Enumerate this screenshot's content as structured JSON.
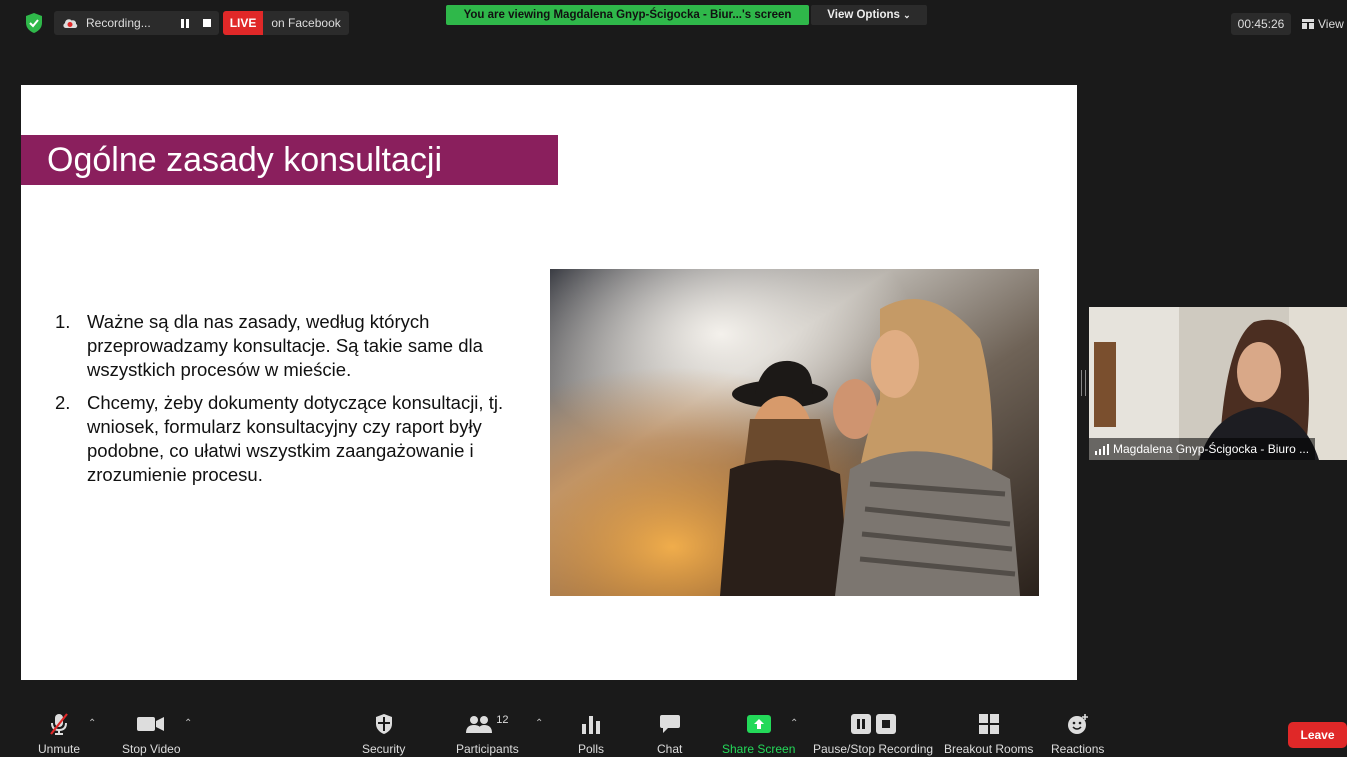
{
  "topbar": {
    "recording_label": "Recording...",
    "live_tag": "LIVE",
    "live_platform": "on Facebook",
    "viewing_banner": "You are viewing Magdalena Gnyp-Ścigocka - Biur...'s screen",
    "view_options_label": "View Options",
    "timer": "00:45:26",
    "view_label": "View"
  },
  "slide": {
    "title": "Ogólne zasady konsultacji",
    "items": [
      {
        "num": "1.",
        "text": "Ważne są dla nas zasady, według których przeprowadzamy konsultacje. Są takie same dla wszystkich procesów w mieście."
      },
      {
        "num": "2.",
        "text": "Chcemy, żeby dokumenty dotyczące konsultacji, tj. wniosek, formularz konsultacyjny czy raport były podobne, co ułatwi wszystkim zaangażowanie i zrozumienie procesu."
      }
    ]
  },
  "participant_video": {
    "name": "Magdalena Gnyp-Ścigocka - Biuro ..."
  },
  "toolbar": {
    "unmute": "Unmute",
    "stop_video": "Stop Video",
    "security": "Security",
    "participants": "Participants",
    "participants_count": "12",
    "polls": "Polls",
    "chat": "Chat",
    "share_screen": "Share Screen",
    "pause_stop_recording": "Pause/Stop Recording",
    "breakout_rooms": "Breakout Rooms",
    "reactions": "Reactions",
    "leave": "Leave"
  },
  "colors": {
    "live_red": "#e02828",
    "banner_green": "#2fb84a",
    "title_band": "#8a1f5d",
    "share_green": "#23d959"
  }
}
